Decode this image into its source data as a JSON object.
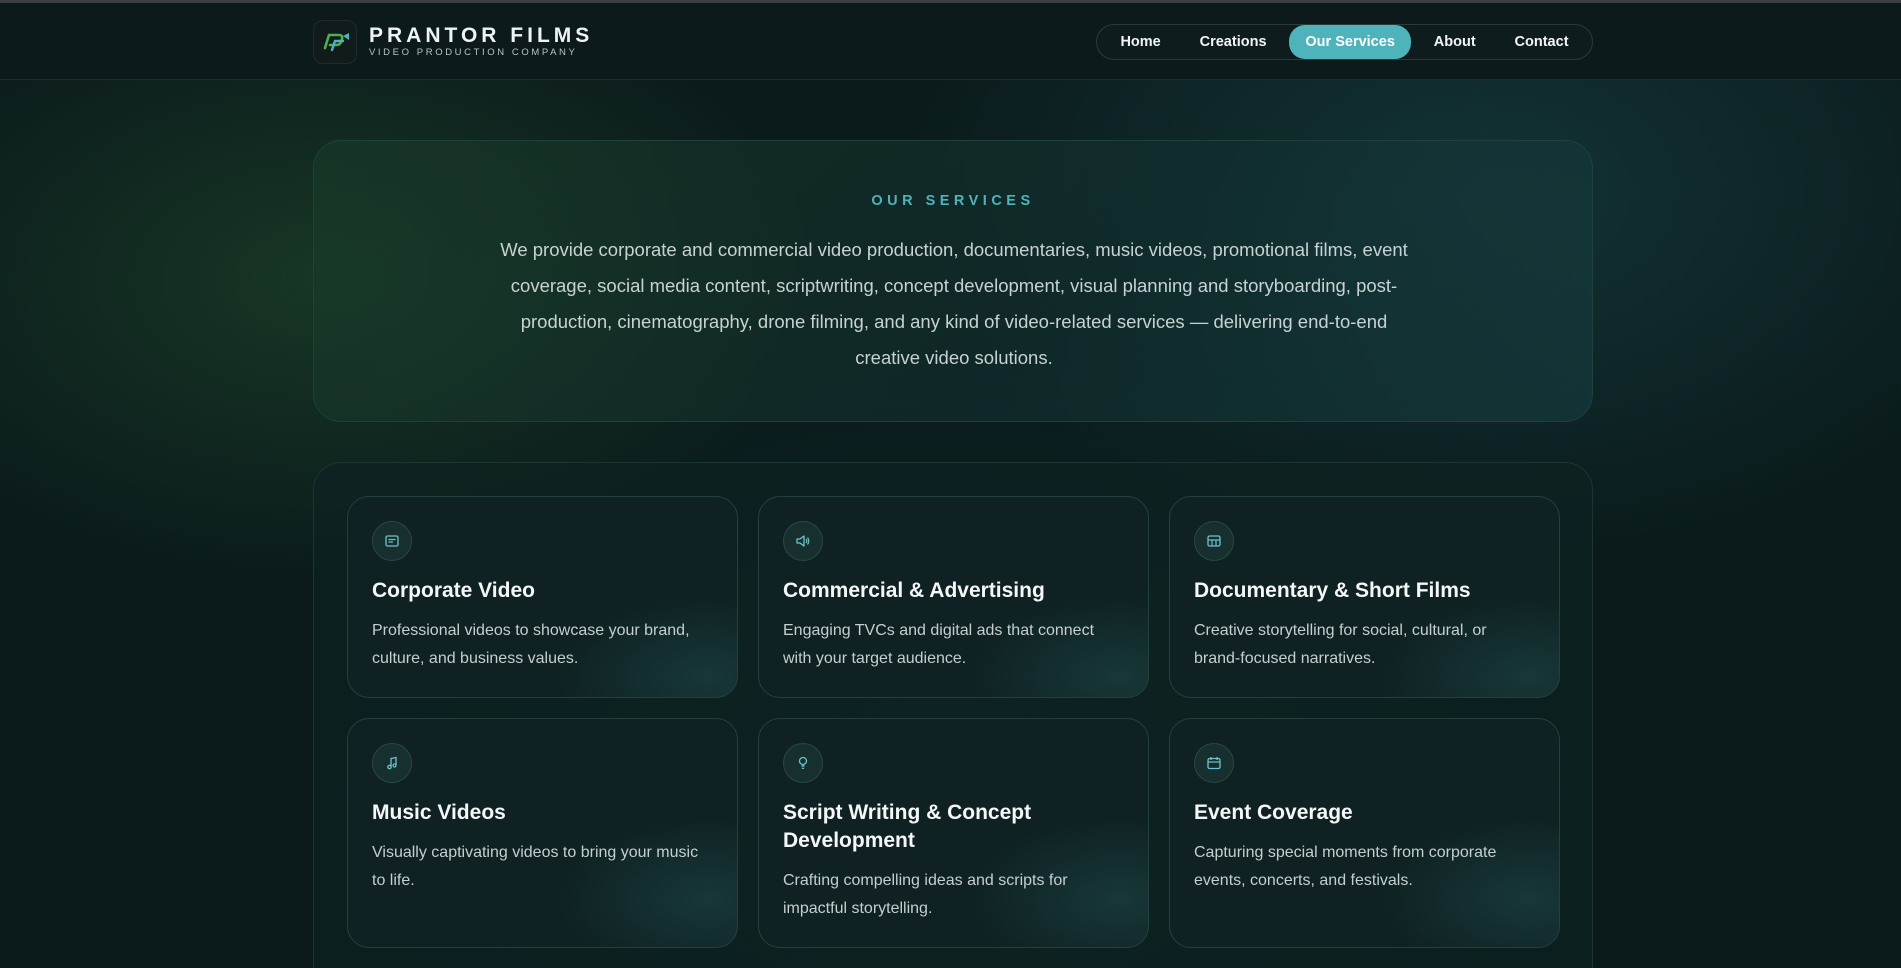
{
  "brand": {
    "name": "PRANTOR FILMS",
    "tagline": "VIDEO PRODUCTION COMPANY",
    "logo_icon": "film-logo-icon",
    "colors": {
      "accent": "#4fb3bb",
      "logo_green": "#4caf50"
    }
  },
  "nav": {
    "items": [
      {
        "label": "Home",
        "active": false
      },
      {
        "label": "Creations",
        "active": false
      },
      {
        "label": "Our Services",
        "active": true
      },
      {
        "label": "About",
        "active": false
      },
      {
        "label": "Contact",
        "active": false
      }
    ]
  },
  "intro": {
    "eyebrow": "OUR SERVICES",
    "text": "We provide corporate and commercial video production, documentaries, music videos, promotional films, event coverage, social media content, scriptwriting, concept development, visual planning and storyboarding, post-production, cinematography, drone filming, and any kind of video-related services — delivering end-to-end creative video solutions."
  },
  "services": [
    {
      "icon": "briefcase-icon",
      "title": "Corporate Video",
      "desc": "Professional videos to showcase your brand, culture, and business values."
    },
    {
      "icon": "megaphone-icon",
      "title": "Commercial & Advertising",
      "desc": "Engaging TVCs and digital ads that connect with your target audience."
    },
    {
      "icon": "film-icon",
      "title": "Documentary & Short Films",
      "desc": "Creative storytelling for social, cultural, or brand-focused narratives."
    },
    {
      "icon": "music-note-icon",
      "title": "Music Videos",
      "desc": "Visually captivating videos to bring your music to life."
    },
    {
      "icon": "lightbulb-icon",
      "title": "Script Writing & Concept Development",
      "desc": "Crafting compelling ideas and scripts for impactful storytelling."
    },
    {
      "icon": "calendar-icon",
      "title": "Event Coverage",
      "desc": "Capturing special moments from corporate events, concerts, and festivals."
    }
  ]
}
